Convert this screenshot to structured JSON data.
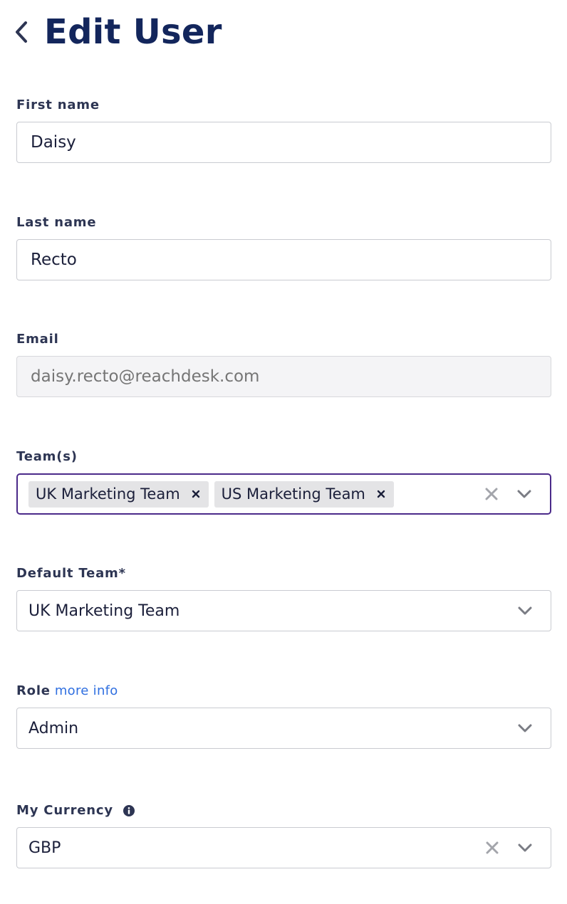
{
  "header": {
    "title": "Edit User",
    "back_icon": "chevron-left-icon"
  },
  "form": {
    "first_name": {
      "label": "First name",
      "value": "Daisy"
    },
    "last_name": {
      "label": "Last name",
      "value": "Recto"
    },
    "email": {
      "label": "Email",
      "placeholder": "daisy.recto@reachdesk.com",
      "disabled": true
    },
    "teams": {
      "label": "Team(s)",
      "selected": [
        "UK Marketing Team",
        "US Marketing Team"
      ],
      "focused": true
    },
    "default_team": {
      "label": "Default Team*",
      "value": "UK Marketing Team"
    },
    "role": {
      "label": "Role",
      "link": "more info",
      "value": "Admin"
    },
    "currency": {
      "label": "My Currency",
      "info_icon": "info-icon",
      "value": "GBP"
    }
  },
  "colors": {
    "title": "#13265c",
    "label": "#2d3553",
    "link": "#2f6fe0",
    "focus_border": "#4b2a8a",
    "chip_bg": "#e4e4e6",
    "disabled_bg": "#f4f4f6"
  }
}
